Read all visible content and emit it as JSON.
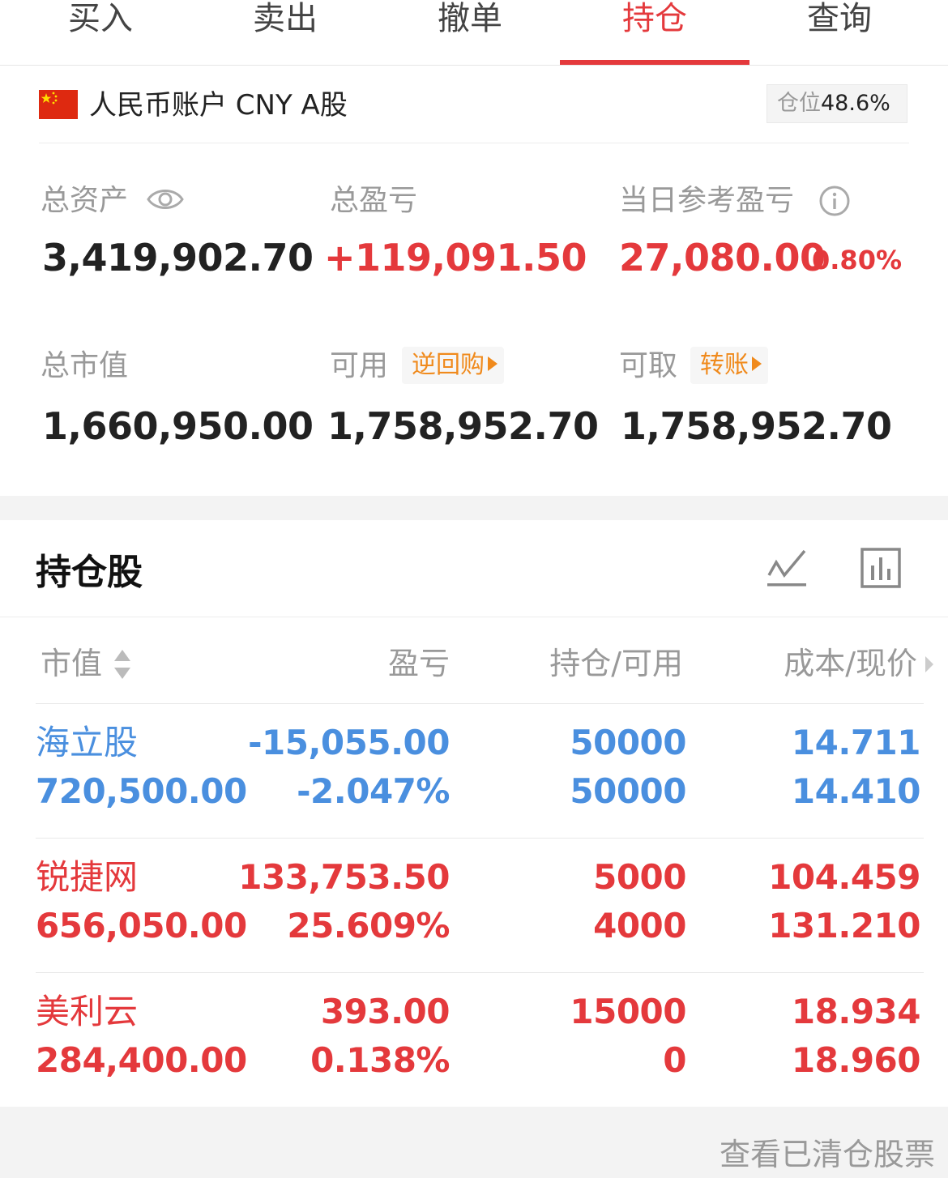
{
  "tabs": [
    {
      "label": "买入"
    },
    {
      "label": "卖出"
    },
    {
      "label": "撤单"
    },
    {
      "label": "持仓",
      "active": true
    },
    {
      "label": "查询"
    }
  ],
  "account": {
    "title": "人民币账户 CNY A股",
    "position_label": "仓位",
    "position_value": "48.6%"
  },
  "summary": {
    "total_assets_label": "总资产",
    "total_assets": "3,419,902.70",
    "total_pnl_label": "总盈亏",
    "total_pnl": "+119,091.50",
    "daily_pnl_label": "当日参考盈亏",
    "daily_pnl": "27,080.00",
    "daily_pnl_pct": "0.80%",
    "market_value_label": "总市值",
    "market_value": "1,660,950.00",
    "available_label": "可用",
    "available_tag": "逆回购",
    "available": "1,758,952.70",
    "withdrawable_label": "可取",
    "withdrawable_tag": "转账",
    "withdrawable": "1,758,952.70"
  },
  "holdings": {
    "title": "持仓股",
    "columns": [
      "市值",
      "盈亏",
      "持仓/可用",
      "成本/现价"
    ],
    "rows": [
      {
        "name": "海立股",
        "market_value": "720,500.00",
        "pnl": "-15,055.00",
        "pnl_pct": "-2.047%",
        "position": "50000",
        "available": "50000",
        "cost": "14.711",
        "price": "14.410",
        "color": "#4a8fdf"
      },
      {
        "name": "锐捷网",
        "market_value": "656,050.00",
        "pnl": "133,753.50",
        "pnl_pct": "25.609%",
        "position": "5000",
        "available": "4000",
        "cost": "104.459",
        "price": "131.210",
        "color": "#e4393c"
      },
      {
        "name": "美利云",
        "market_value": "284,400.00",
        "pnl": "393.00",
        "pnl_pct": "0.138%",
        "position": "15000",
        "available": "0",
        "cost": "18.934",
        "price": "18.960",
        "color": "#e4393c"
      }
    ]
  },
  "footer": {
    "text": "查看已清仓股票"
  },
  "colors": {
    "accent": "#e4393c",
    "loss": "#4a8fdf",
    "tag": "#f08a1c"
  }
}
